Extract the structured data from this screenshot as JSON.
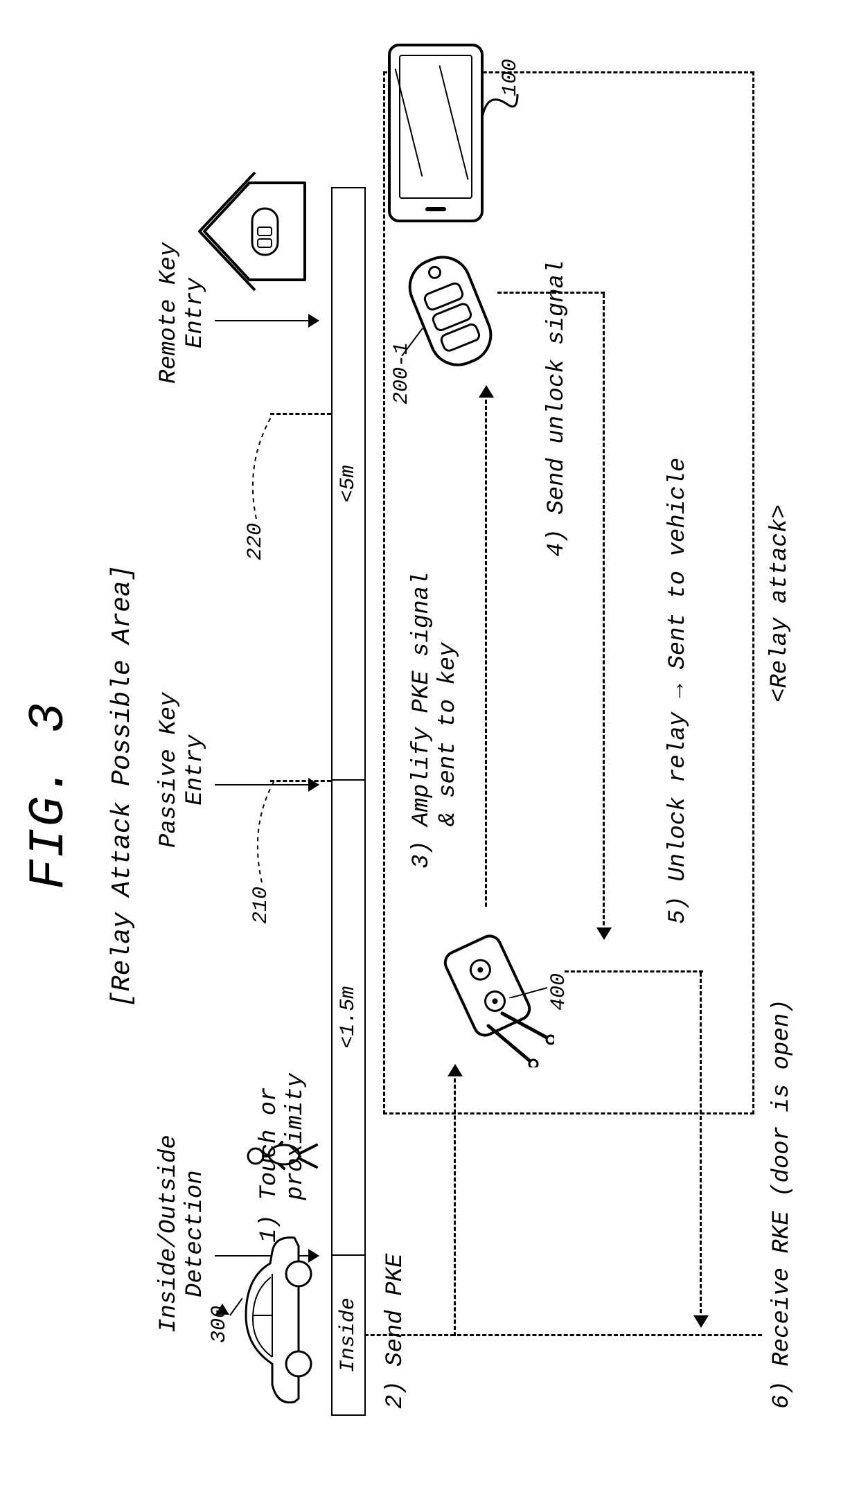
{
  "figure": {
    "title": "FIG. 3",
    "subtitle": "[Relay Attack Possible Area]"
  },
  "zones": {
    "inside_outside": "Inside/Outside\nDetection",
    "pke": "Passive Key\nEntry",
    "rke": "Remote Key\nEntry"
  },
  "range_bar": {
    "seg1": "Inside",
    "seg2": "<1.5m",
    "seg3": "<5m"
  },
  "refs": {
    "r300": "300",
    "r210": "210",
    "r220": "220",
    "r100": "100",
    "r200_1": "200-1",
    "r400": "400"
  },
  "steps": {
    "s1": "1) Touch or\n   proximity",
    "s2": "2) Send PKE",
    "s3": "3) Amplify PKE signal\n   & sent to key",
    "s4": "4) Send unlock signal",
    "s5": "5) Unlock relay → Sent to vehicle",
    "s6": "6) Receive RKE (door is open)"
  },
  "footer": "<Relay attack>",
  "chart_data": {
    "type": "diagram",
    "title": "Relay Attack Possible Area",
    "zones": [
      {
        "name": "Inside/Outside Detection",
        "range": "Inside"
      },
      {
        "name": "Passive Key Entry",
        "range": "<1.5m",
        "ref": 210
      },
      {
        "name": "Remote Key Entry",
        "range": "<5m",
        "ref": 220
      }
    ],
    "entities": [
      {
        "ref": 300,
        "name": "Vehicle"
      },
      {
        "ref": 400,
        "name": "Relay device"
      },
      {
        "ref": "200-1",
        "name": "Smart key fob"
      },
      {
        "ref": 100,
        "name": "Smartphone"
      }
    ],
    "sequence": [
      {
        "n": 1,
        "text": "Touch or proximity",
        "from": "person",
        "to": "vehicle"
      },
      {
        "n": 2,
        "text": "Send PKE",
        "from": "vehicle",
        "to": "relay device"
      },
      {
        "n": 3,
        "text": "Amplify PKE signal & sent to key",
        "from": "relay device",
        "to": "key fob"
      },
      {
        "n": 4,
        "text": "Send unlock signal",
        "from": "key fob",
        "to": "relay device"
      },
      {
        "n": 5,
        "text": "Unlock relay → Sent to vehicle",
        "from": "relay device",
        "to": "vehicle"
      },
      {
        "n": 6,
        "text": "Receive RKE (door is open)",
        "at": "vehicle"
      }
    ]
  }
}
